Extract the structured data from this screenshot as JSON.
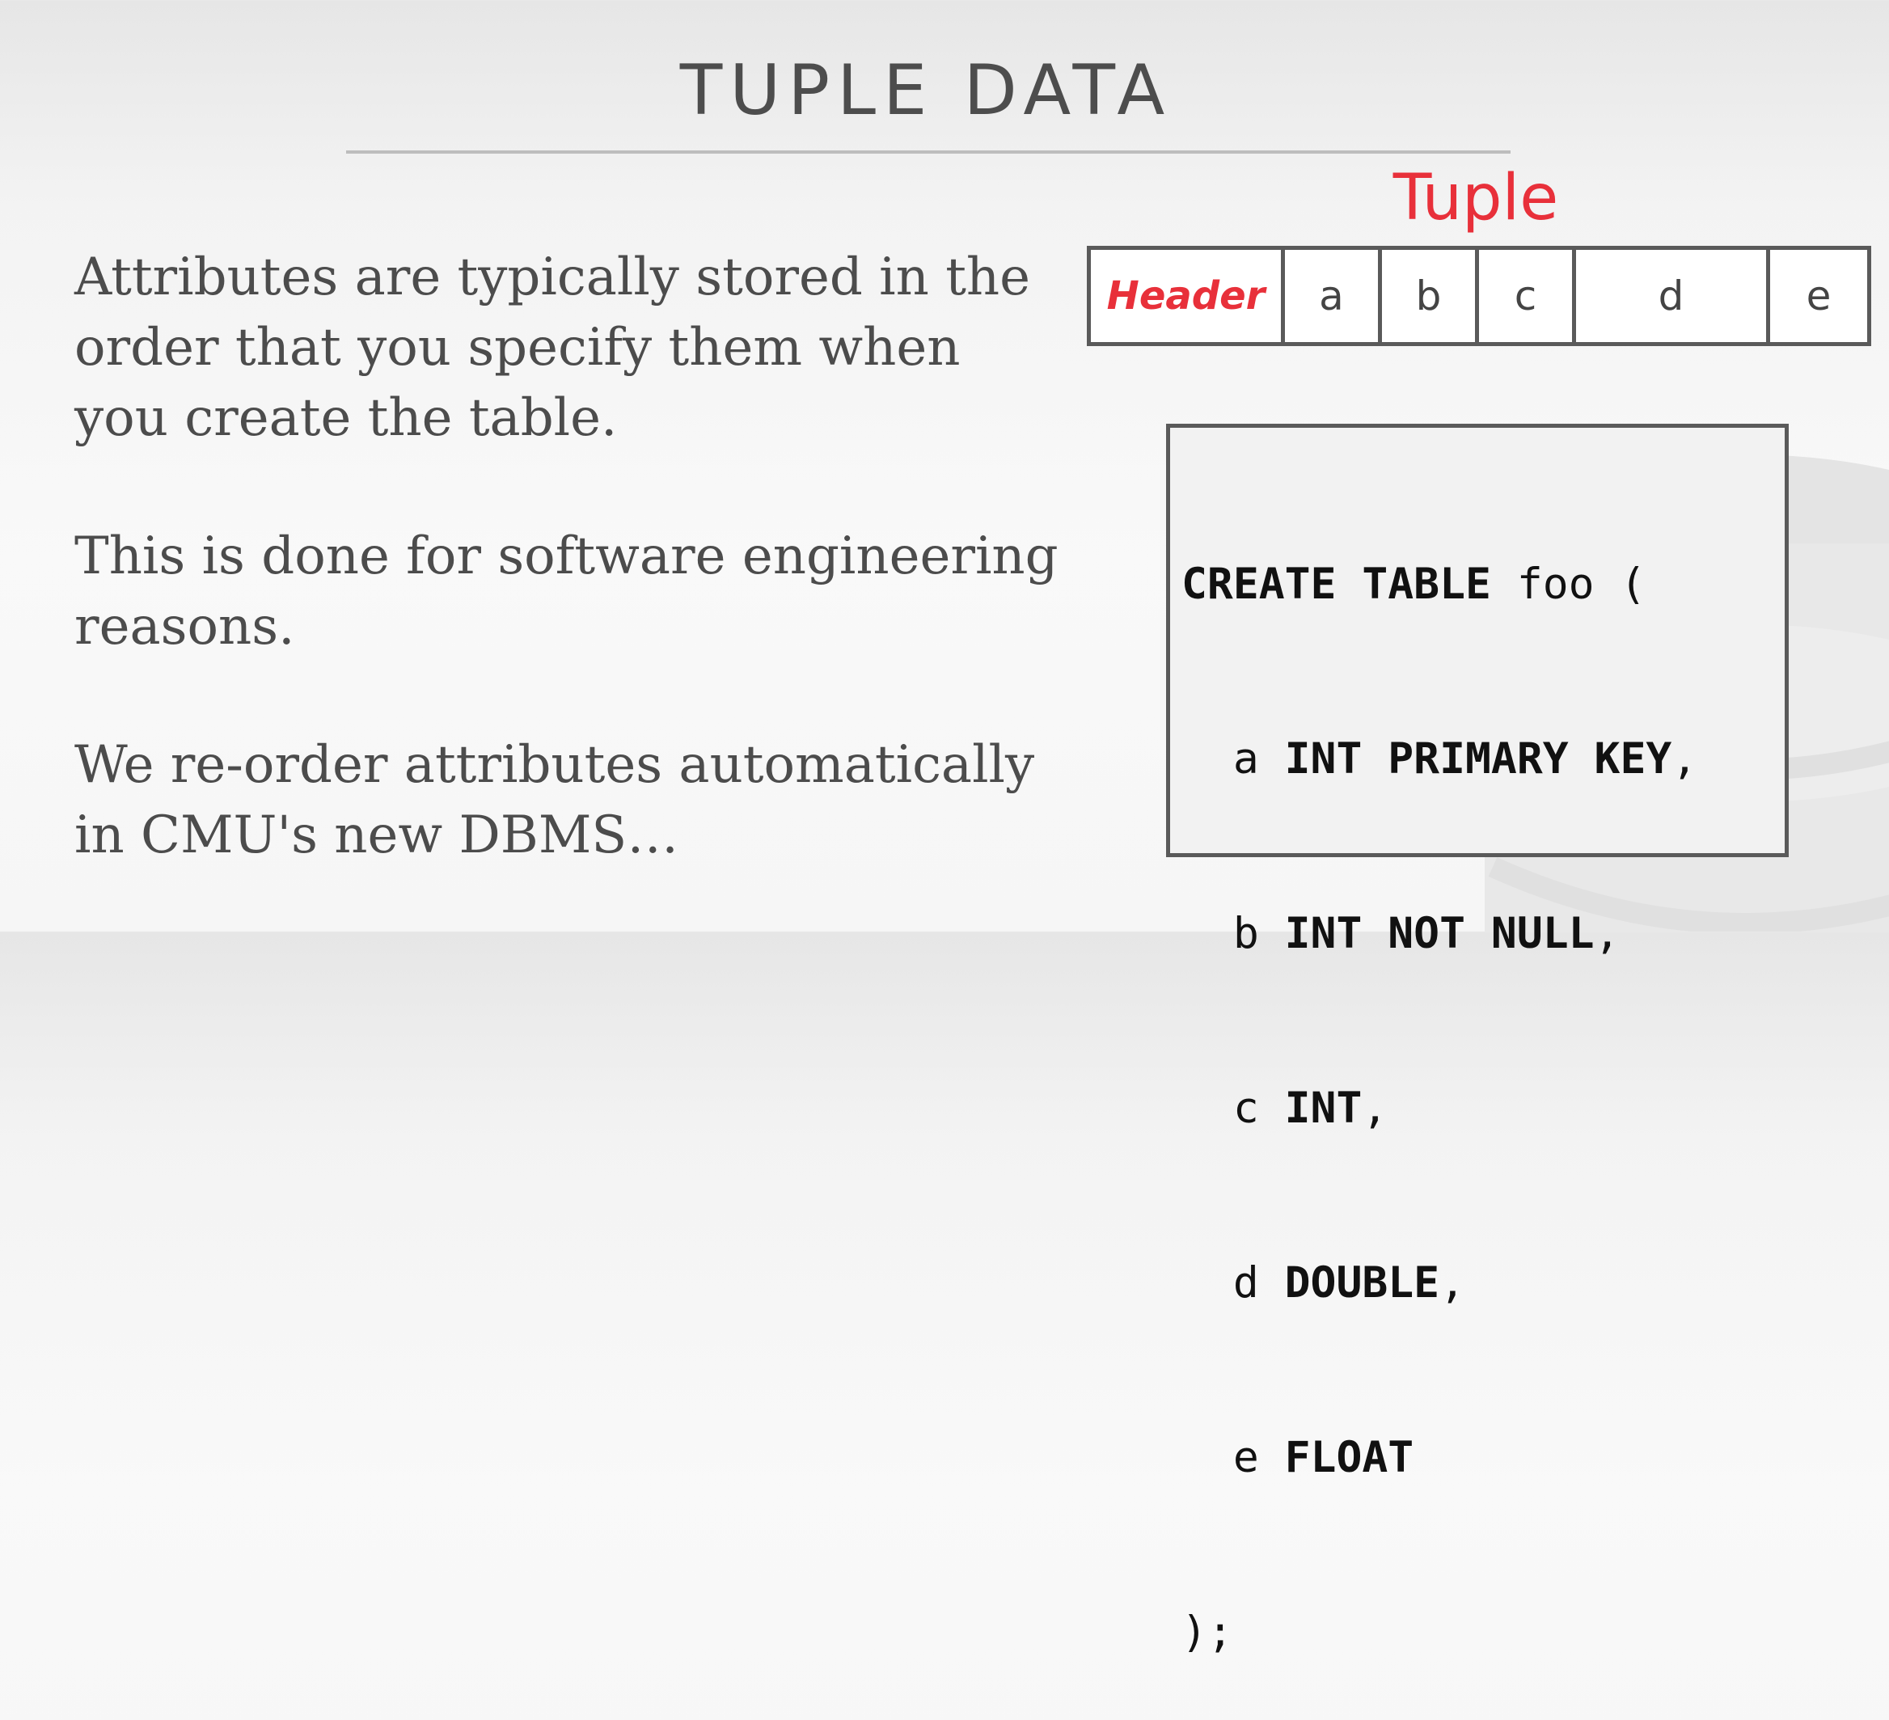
{
  "slide": {
    "title": "TUPLE DATA",
    "bullets": [
      "Attributes are typically stored in the order that you specify them when you create the table.",
      "This is done for software engineering reasons.",
      "We re-order attributes automatically in CMU's new DBMS…"
    ]
  },
  "tuple": {
    "label": "Tuple",
    "cells": [
      "Header",
      "a",
      "b",
      "c",
      "d",
      "e"
    ]
  },
  "code": {
    "lines": [
      {
        "kw": "CREATE TABLE",
        "rest": " foo ("
      },
      {
        "pre": "  a ",
        "kw": "INT PRIMARY KEY",
        "rest": ","
      },
      {
        "pre": "  b ",
        "kw": "INT NOT NULL",
        "rest": ","
      },
      {
        "pre": "  c ",
        "kw": "INT",
        "rest": ","
      },
      {
        "pre": "  d ",
        "kw": "DOUBLE",
        "rest": ","
      },
      {
        "pre": "  e ",
        "kw": "FLOAT",
        "rest": ""
      },
      {
        "rest": ");"
      }
    ]
  },
  "colors": {
    "accent": "#e8303a",
    "text": "#4c4c4c",
    "border": "#5a5a5a"
  }
}
